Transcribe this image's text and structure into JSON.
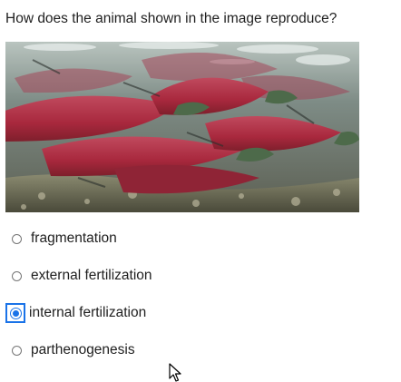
{
  "question": {
    "text": "How does the animal shown in the image reproduce?"
  },
  "image": {
    "subject": "sockeye salmon"
  },
  "options": [
    {
      "label": "fragmentation",
      "selected": false
    },
    {
      "label": "external fertilization",
      "selected": false
    },
    {
      "label": "internal fertilization",
      "selected": true
    },
    {
      "label": "parthenogenesis",
      "selected": false
    }
  ],
  "colors": {
    "accent": "#1a73e8",
    "text": "#1f1f1f"
  }
}
